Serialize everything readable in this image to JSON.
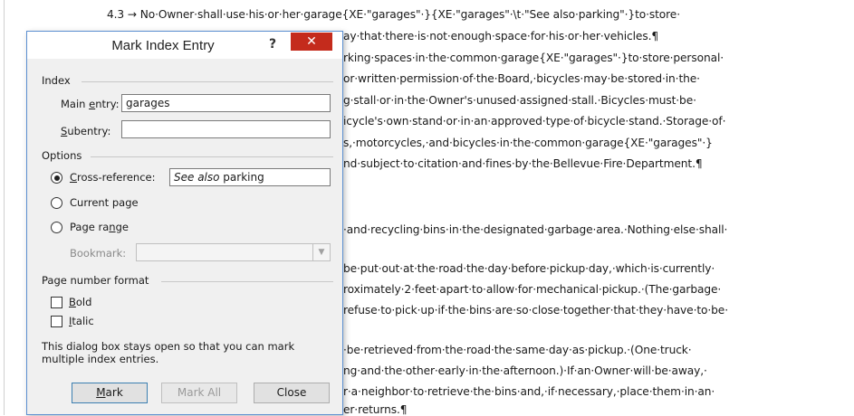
{
  "document": {
    "lines": [
      "4.3 → No·Owner·shall·use·his·or·her·garage{XE·\"garages\"·}{XE·\"garages\"·\\t·\"See also·parking\"·}to·store·",
      "ay·that·there·is·not·enough·space·for·his·or·her·vehicles.¶",
      "rking·spaces·in·the·common·garage{XE·\"garages\"·}to·store·personal·",
      "or·written·permission·of·the·Board,·bicycles·may·be·stored·in·the·",
      "g·stall·or·in·the·Owner's·unused·assigned·stall.·Bicycles·must·be·",
      "icycle's·own·stand·or·in·an·approved·type·of·bicycle·stand.·Storage·of·",
      "s,·motorcycles,·and·bicycles·in·the·common·garage{XE·\"garages\"·}",
      "nd·subject·to·citation·and·fines·by·the·Bellevue·Fire·Department.¶",
      "·and·recycling·bins·in·the·designated·garbage·area.·Nothing·else·shall·",
      "be·put·out·at·the·road·the·day·before·pickup·day,·which·is·currently·",
      "roximately·2·feet·apart·to·allow·for·mechanical·pickup.·(The·garbage·",
      "refuse·to·pick·up·if·the·bins·are·so·close·together·that·they·have·to·be·",
      "·be·retrieved·from·the·road·the·same·day·as·pickup.·(One·truck·",
      "ng·and·the·other·early·in·the·afternoon.)·If·an·Owner·will·be·away,·",
      "r·a·neighbor·to·retrieve·the·bins·and,·if·necessary,·place·them·in·an·",
      "er·returns.¶"
    ]
  },
  "dialog": {
    "title": "Mark Index Entry",
    "help_label": "?",
    "close_glyph": "✕",
    "index": {
      "section_label": "Index",
      "main_entry_label_prefix": "Main ",
      "main_entry_label_key": "e",
      "main_entry_label_suffix": "ntry:",
      "main_entry_value": "garages",
      "subentry_label_key": "S",
      "subentry_label_suffix": "ubentry:",
      "subentry_value": ""
    },
    "options": {
      "section_label": "Options",
      "cross_reference_key": "C",
      "cross_reference_rest": "ross-reference:",
      "cross_reference_value_italic": "See also",
      "cross_reference_value_rest": " parking",
      "current_page_label": "Current page",
      "page_range_prefix": "Page ra",
      "page_range_key": "n",
      "page_range_suffix": "ge",
      "bookmark_label": "Bookmark:",
      "selected": "cross-reference"
    },
    "page_number_format": {
      "section_label": "Page number format",
      "bold_key": "B",
      "bold_rest": "old",
      "italic_key": "I",
      "italic_rest": "talic",
      "bold_checked": false,
      "italic_checked": false
    },
    "note": "This dialog box stays open so that you can mark multiple index entries.",
    "buttons": {
      "mark_key": "M",
      "mark_rest": "ark",
      "mark_all": "Mark All",
      "close": "Close"
    }
  },
  "colors": {
    "close_button": "#c42b1c",
    "dialog_border": "#5b8fd0",
    "dialog_bg": "#f0f0f0"
  }
}
